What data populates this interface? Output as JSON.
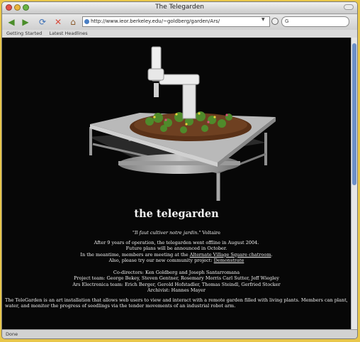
{
  "window": {
    "title": "The Telegarden"
  },
  "toolbar": {
    "url": "http://www.ieor.berkeley.edu/~goldberg/garden/Ars/",
    "search_placeholder": "G"
  },
  "bookmarks": [
    "Getting Started",
    "Latest Headlines"
  ],
  "page": {
    "heading": "the telegarden",
    "quote_text": "\"Il faut cultiver notre jardin.\"",
    "quote_author": "Voltaire",
    "info_line1": "After 9 years of operation, the telegarden went offline in August 2004.",
    "info_line2": "Future plans will be announced in October.",
    "info_line3_prefix": "In the meantime, members are meeting at the",
    "info_line3_link": "Alternate Village Square chatroom",
    "info_line3_suffix": ".",
    "info_line4_prefix": "Also, please try our new community project:",
    "info_line4_link": "Demonstrate",
    "credits": [
      "Co-directors: Ken Goldberg and Joseph Santarromana",
      "Project team: George Bekey, Steven Gentner, Rosemary Morris Carl Sutter, Jeff Wiegley",
      "Ars Electronica team: Erich Berger, Gerold Hofstadler, Thomas Steindl, Gerfried Stocker",
      "Archivist: Hannes Mayer"
    ],
    "description": "The TeleGarden is an art installation that allows web users to view and interact with a remote garden filled with living plants. Members can plant, water, and monitor the progress of seedlings via the tender movements of an industrial robot arm."
  },
  "status": {
    "text": "Done"
  },
  "colors": {
    "page_bg": "#070707",
    "accent_scroll": "#6c8fc8"
  }
}
